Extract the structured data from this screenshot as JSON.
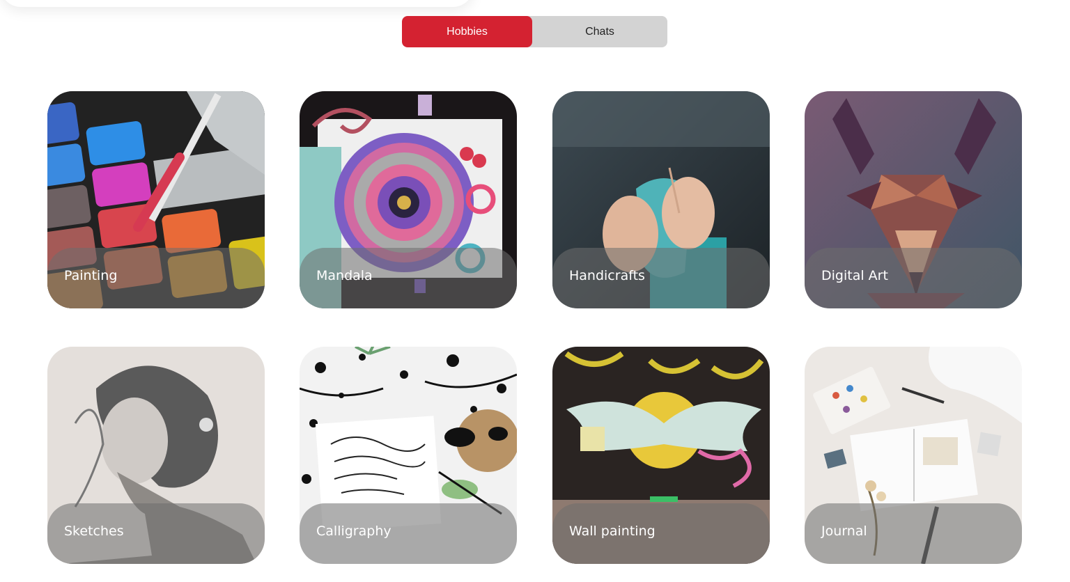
{
  "tabs": {
    "active_label": "Hobbies",
    "inactive_label": "Chats",
    "active_color": "#d42231",
    "inactive_color": "#d3d3d3"
  },
  "hobbies": [
    {
      "label": "Painting",
      "image": "watercolor-palette-photo"
    },
    {
      "label": "Mandala",
      "image": "mandala-drawing-photo"
    },
    {
      "label": "Handicrafts",
      "image": "knitting-hands-photo"
    },
    {
      "label": "Digital Art",
      "image": "low-poly-deer-illustration"
    },
    {
      "label": "Sketches",
      "image": "pencil-portrait-sketch"
    },
    {
      "label": "Calligraphy",
      "image": "calligraphy-card-photo"
    },
    {
      "label": "Wall painting",
      "image": "graffiti-wings-mural-photo"
    },
    {
      "label": "Journal",
      "image": "journal-flatlay-photo"
    }
  ]
}
